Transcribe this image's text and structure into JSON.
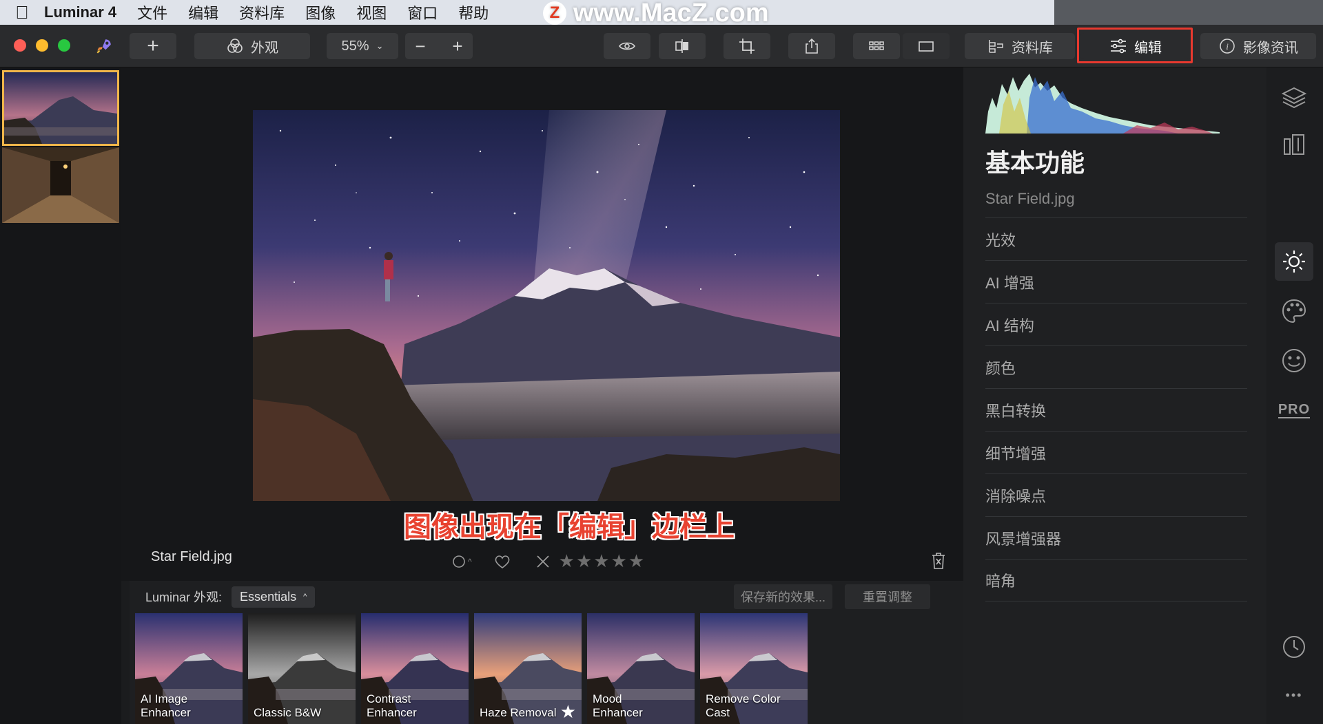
{
  "menubar": {
    "app_name": "Luminar 4",
    "items": [
      "文件",
      "编辑",
      "资料库",
      "图像",
      "视图",
      "窗口",
      "帮助"
    ]
  },
  "watermark": {
    "badge": "Z",
    "text": "www.MacZ.com"
  },
  "toolbar": {
    "add_label": "+",
    "looks_label": "外观",
    "zoom_value": "55%",
    "zoom_out": "−",
    "zoom_in": "+",
    "library_label": "资料库",
    "edit_label": "编辑",
    "info_label": "影像资讯"
  },
  "viewer": {
    "file_name": "Star Field.jpg",
    "annotation": "图像出现在「编辑」边栏上",
    "rating_stars": 5
  },
  "looks": {
    "label": "Luminar 外观:",
    "category": "Essentials",
    "save_label": "保存新的效果...",
    "reset_label": "重置调整",
    "items": [
      {
        "name": "AI Image\nEnhancer"
      },
      {
        "name": "Classic B&W"
      },
      {
        "name": "Contrast\nEnhancer"
      },
      {
        "name": "Haze Removal",
        "favorite": true
      },
      {
        "name": "Mood\nEnhancer"
      },
      {
        "name": "Remove Color\nCast"
      }
    ]
  },
  "panel": {
    "title": "基本功能",
    "subtitle": "Star Field.jpg",
    "sections": [
      "光效",
      "AI 增强",
      "AI 结构",
      "颜色",
      "黑白转换",
      "细节增强",
      "消除噪点",
      "风景增强器",
      "暗角"
    ]
  },
  "sidebar_icons": {
    "pro_label": "PRO",
    "more_label": "•••"
  },
  "colors": {
    "accent_red": "#e8392f",
    "highlight_frame": "#f0b64a"
  }
}
